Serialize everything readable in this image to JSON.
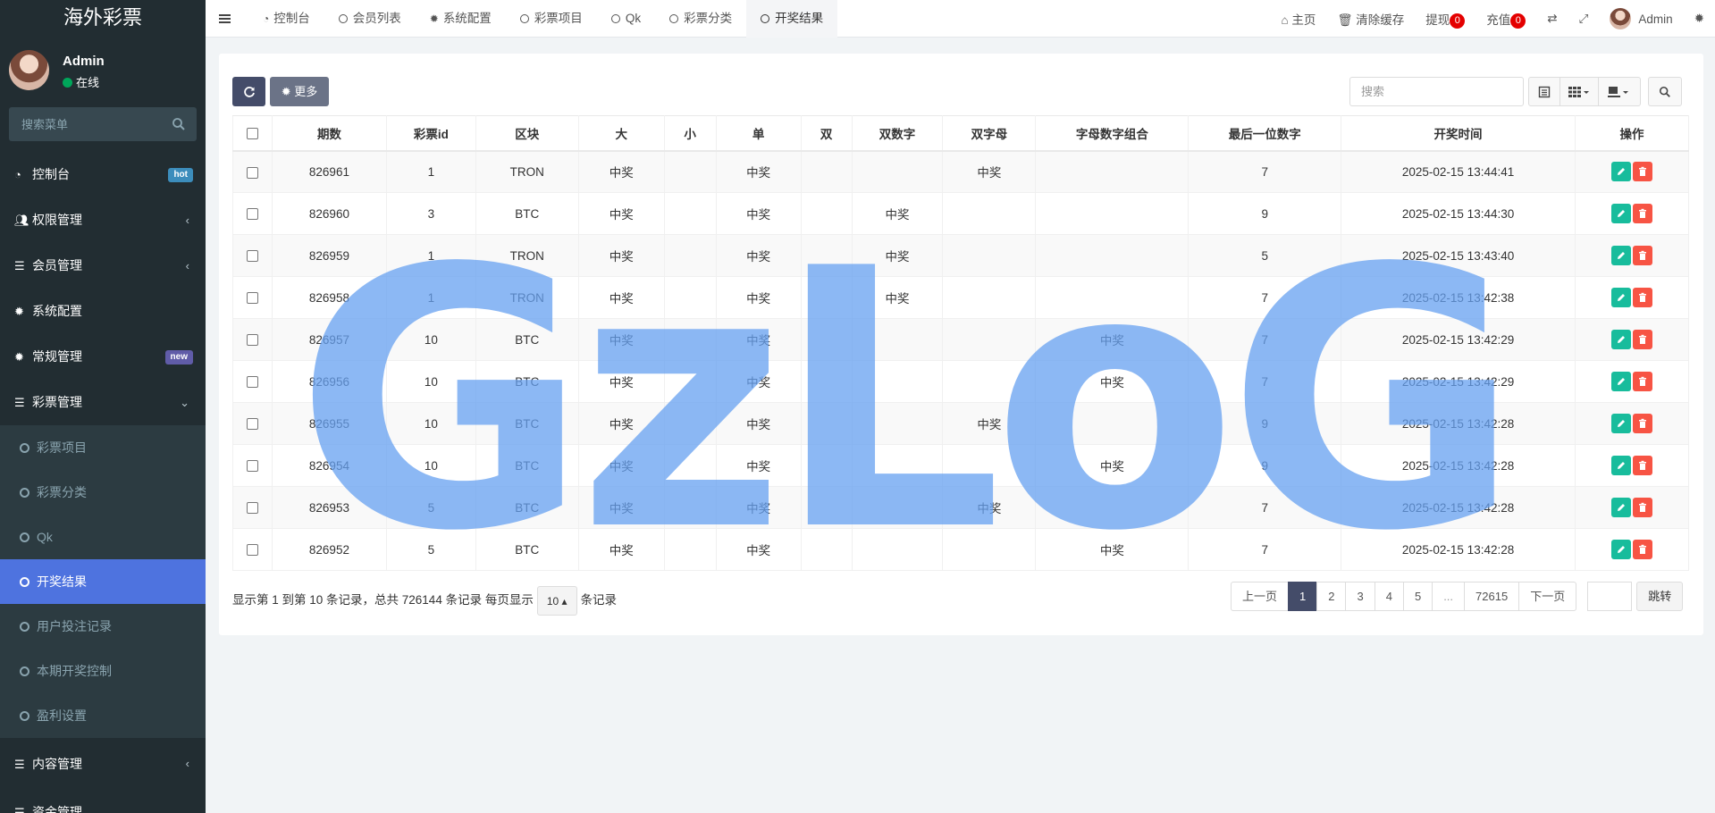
{
  "sidebar": {
    "logo": "海外彩票",
    "user_name": "Admin",
    "user_status": "在线",
    "search_placeholder": "搜索菜单",
    "menu": [
      {
        "label": "控制台",
        "icon": "dashboard-icon",
        "badge": "hot"
      },
      {
        "label": "权限管理",
        "icon": "users-icon"
      },
      {
        "label": "会员管理",
        "icon": "list-icon"
      },
      {
        "label": "系统配置",
        "icon": "gear-icon"
      },
      {
        "label": "常规管理",
        "icon": "gears-icon",
        "badge": "new"
      },
      {
        "label": "彩票管理",
        "icon": "list-icon"
      }
    ],
    "submenu": [
      "彩票项目",
      "彩票分类",
      "Qk",
      "开奖结果",
      "用户投注记录",
      "本期开奖控制",
      "盈利设置"
    ],
    "menu_after": [
      "内容管理",
      "资金管理"
    ]
  },
  "topnav": {
    "tabs": [
      "控制台",
      "会员列表",
      "系统配置",
      "彩票项目",
      "Qk",
      "彩票分类",
      "开奖结果"
    ],
    "home": "主页",
    "clear_cache": "清除缓存",
    "withdraw": "提现",
    "withdraw_count": "0",
    "recharge": "充值",
    "recharge_count": "0",
    "admin": "Admin"
  },
  "toolbar": {
    "more_label": "更多",
    "search_placeholder": "搜索"
  },
  "table": {
    "headers": [
      "期数",
      "彩票id",
      "区块",
      "大",
      "小",
      "单",
      "双",
      "双数字",
      "双字母",
      "字母数字组合",
      "最后一位数字",
      "开奖时间",
      "操作"
    ],
    "rows": [
      [
        "826961",
        "1",
        "TRON",
        "中奖",
        "",
        "中奖",
        "",
        "",
        "中奖",
        "",
        "7",
        "2025-02-15 13:44:41"
      ],
      [
        "826960",
        "3",
        "BTC",
        "中奖",
        "",
        "中奖",
        "",
        "中奖",
        "",
        "",
        "9",
        "2025-02-15 13:44:30"
      ],
      [
        "826959",
        "1",
        "TRON",
        "中奖",
        "",
        "中奖",
        "",
        "中奖",
        "",
        "",
        "5",
        "2025-02-15 13:43:40"
      ],
      [
        "826958",
        "1",
        "TRON",
        "中奖",
        "",
        "中奖",
        "",
        "中奖",
        "",
        "",
        "7",
        "2025-02-15 13:42:38"
      ],
      [
        "826957",
        "10",
        "BTC",
        "中奖",
        "",
        "中奖",
        "",
        "",
        "",
        "中奖",
        "7",
        "2025-02-15 13:42:29"
      ],
      [
        "826956",
        "10",
        "BTC",
        "中奖",
        "",
        "中奖",
        "",
        "",
        "",
        "中奖",
        "7",
        "2025-02-15 13:42:29"
      ],
      [
        "826955",
        "10",
        "BTC",
        "中奖",
        "",
        "中奖",
        "",
        "",
        "中奖",
        "",
        "9",
        "2025-02-15 13:42:28"
      ],
      [
        "826954",
        "10",
        "BTC",
        "中奖",
        "",
        "中奖",
        "",
        "",
        "",
        "中奖",
        "9",
        "2025-02-15 13:42:28"
      ],
      [
        "826953",
        "5",
        "BTC",
        "中奖",
        "",
        "中奖",
        "",
        "",
        "中奖",
        "",
        "7",
        "2025-02-15 13:42:28"
      ],
      [
        "826952",
        "5",
        "BTC",
        "中奖",
        "",
        "中奖",
        "",
        "",
        "",
        "中奖",
        "7",
        "2025-02-15 13:42:28"
      ]
    ]
  },
  "footer": {
    "info_prefix": "显示第 1 到第 10 条记录，总共 726144 条记录 每页显示",
    "page_size": "10",
    "info_suffix": "条记录"
  },
  "pagination": {
    "prev": "上一页",
    "pages": [
      "1",
      "2",
      "3",
      "4",
      "5",
      "...",
      "72615"
    ],
    "active": "1",
    "next": "下一页",
    "go": "跳转"
  },
  "watermark": "GzLoG",
  "colors": {
    "sidebar_bg": "#222d32",
    "active_item": "#4e73df",
    "primary_btn": "#444c69",
    "edit_btn": "#18bc9c",
    "delete_btn": "#f75444",
    "badge_red": "#e40000"
  }
}
